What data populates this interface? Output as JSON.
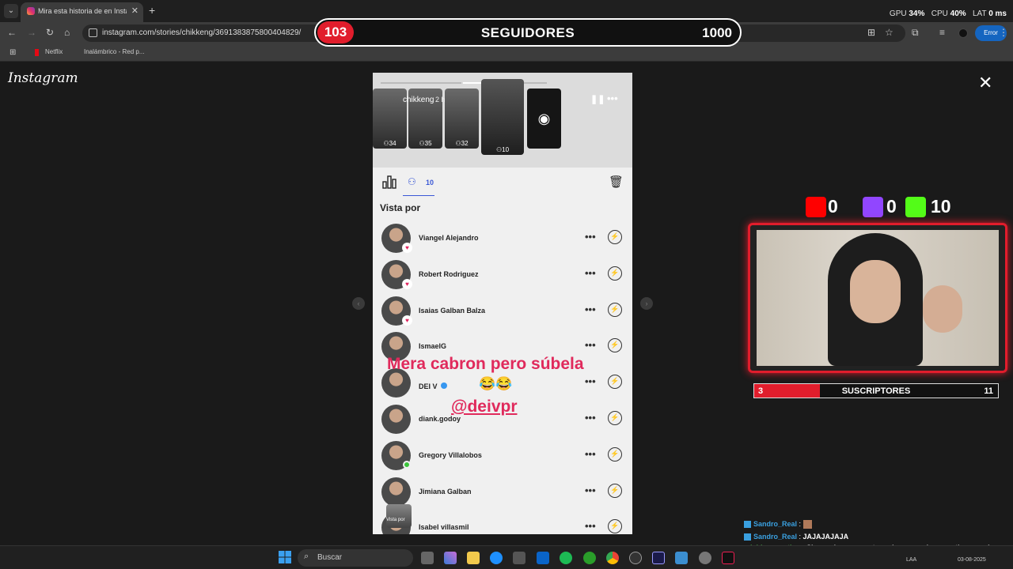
{
  "browser": {
    "tab_title": "Mira esta historia de en Instagram",
    "url": "instagram.com/stories/chikkeng/3691383875800404829/",
    "error_label": "Error",
    "perf": {
      "gpu_label": "GPU",
      "gpu_value": "34%",
      "cpu_label": "CPU",
      "cpu_value": "40%",
      "lat_label": "LAT",
      "lat_value": "0 ms"
    },
    "bookmarks": [
      "Netflix",
      "Inalámbrico - Red p..."
    ]
  },
  "followers_goal": {
    "current": "103",
    "label": "SEGUIDORES",
    "goal": "1000"
  },
  "instagram": {
    "logo": "Instagram",
    "story": {
      "username": "chikkeng",
      "time": "2 h",
      "thumbnails": [
        {
          "count": "34"
        },
        {
          "count": "35"
        },
        {
          "count": "32"
        },
        {
          "count": "10"
        }
      ],
      "viewers_count": "10",
      "viewed_by_label": "Vista por",
      "viewers": [
        {
          "name": "Viangel Alejandro",
          "badge": "heart"
        },
        {
          "name": "Robert Rodriguez",
          "badge": "heart"
        },
        {
          "name": "Isaias Galban Balza",
          "badge": "heart"
        },
        {
          "name": "IsmaelG",
          "badge": ""
        },
        {
          "name": "DEI V",
          "badge": "verified"
        },
        {
          "name": "diank.godoy",
          "badge": ""
        },
        {
          "name": "Gregory Villalobos",
          "badge": "online"
        },
        {
          "name": "Jimiana Galban",
          "badge": ""
        },
        {
          "name": "Isabel villasmil",
          "badge": ""
        }
      ],
      "overlay_caption": "Mera cabron pero súbela",
      "overlay_emoji": "😂😂",
      "overlay_mention": "@deivpr",
      "thumb_small_label": "Vista por"
    }
  },
  "stream": {
    "platforms": [
      {
        "icon": "youtube-icon",
        "value": "0",
        "color": "#ff0000"
      },
      {
        "icon": "twitch-icon",
        "value": "0",
        "color": "#9146ff"
      },
      {
        "icon": "kick-icon",
        "value": "10",
        "color": "#53fc18"
      }
    ],
    "subscribers": {
      "current": "3",
      "label": "SUSCRIPTORES",
      "goal": "11",
      "progress": 0.27
    },
    "chat": [
      {
        "user": "Sandro_Real",
        "message": "",
        "user_color": "#3aa0e0",
        "badge": true,
        "emote": true
      },
      {
        "user": "Sandro_Real",
        "message": "JAJAJAJAJA",
        "user_color": "#3aa0e0",
        "badge": true
      },
      {
        "user": "mishimacreatine",
        "message": "Cheap viewers on streamboo .com (remove the space) @KUjIcJgf",
        "user_color": "#5bd95b",
        "badge": false
      }
    ]
  },
  "taskbar": {
    "search_label": "Buscar",
    "lang": "LAA",
    "date": "03-08-2025"
  }
}
